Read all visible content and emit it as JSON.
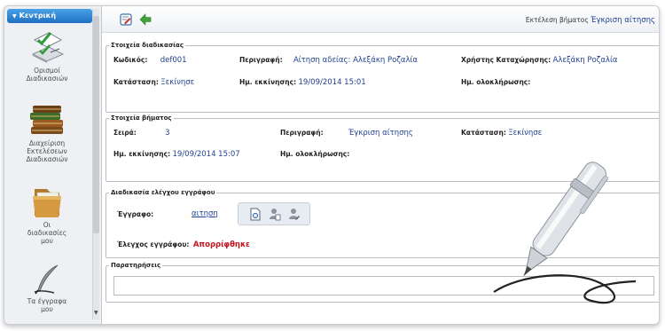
{
  "sidebar": {
    "header": "Κεντρική",
    "items": [
      {
        "label": "Ορισμοί\nΔιαδικασιών",
        "icon": "checklist-icon"
      },
      {
        "label": "Διαχείριση\nΕκτελέσεων\nΔιαδικασιών",
        "icon": "books-icon"
      },
      {
        "label": "Οι\nδιαδικασίες\nμου",
        "icon": "folder-icon"
      },
      {
        "label": "Τα έγγραφα\nμου",
        "icon": "quill-icon"
      }
    ]
  },
  "toolbar": {
    "exec_label": "Εκτέλεση βήματος",
    "exec_value": "Έγκριση αίτησης"
  },
  "process": {
    "legend": "Στοιχεία διαδικασίας",
    "code_label": "Κωδικός:",
    "code": "def001",
    "desc_label": "Περιγραφή:",
    "desc": "Αίτηση αδείας: Αλεξάκη Ροζαλία",
    "user_label": "Χρήστης Καταχώρησης:",
    "user": "Αλεξάκη Ροζαλία",
    "status_label": "Κατάσταση:",
    "status": "Ξεκίνησε",
    "start_label": "Ημ. εκκίνησης:",
    "start": "19/09/2014 15:01",
    "end_label": "Ημ. ολοκλήρωσης:"
  },
  "step": {
    "legend": "Στοιχεία βήματος",
    "order_label": "Σειρά:",
    "order": "3",
    "desc_label": "Περιγραφή:",
    "desc": "Έγκριση αίτησης",
    "status_label": "Κατάσταση:",
    "status": "Ξεκίνησε",
    "start_label": "Ημ. εκκίνησης:",
    "start": "19/09/2014 15:07",
    "end_label": "Ημ. ολοκλήρωσης:"
  },
  "doc_check": {
    "legend": "Διαδικασία ελέγχου εγγράφου",
    "doc_label": "Έγγραφο:",
    "doc": "αιτηση",
    "check_label": "Έλεγχος εγγράφου:",
    "check": "Απορρίφθηκε"
  },
  "notes": {
    "legend": "Παρατηρήσεις"
  },
  "colors": {
    "accent": "#1f6fc0",
    "value_text": "#1f3f8f",
    "rejected": "#c0151e"
  }
}
